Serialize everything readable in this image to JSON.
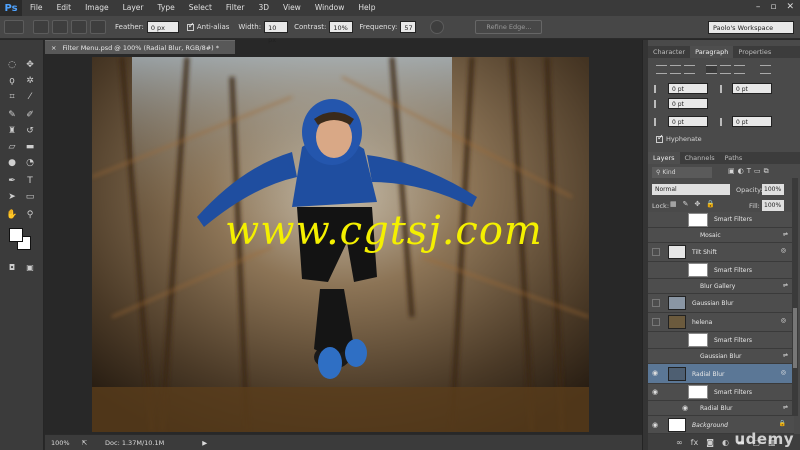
{
  "menu": {
    "app_logo": "Ps",
    "items": [
      "File",
      "Edit",
      "Image",
      "Layer",
      "Type",
      "Select",
      "Filter",
      "3D",
      "View",
      "Window",
      "Help"
    ]
  },
  "options": {
    "feather_label": "Feather:",
    "feather_value": "0 px",
    "antialias_label": "Anti-alias",
    "width_label": "Width:",
    "width_value": "10 px",
    "contrast_label": "Contrast:",
    "contrast_value": "10%",
    "frequency_label": "Frequency:",
    "frequency_value": "57",
    "refine_label": "Refine Edge...",
    "workspace": "Paolo's Workspace"
  },
  "document": {
    "tab_title": "Filter Menu.psd @ 100% (Radial Blur, RGB/8#) *",
    "tab_close": "×",
    "zoom": "100%",
    "doc_size": "Doc: 1.37M/10.1M",
    "watermark": "www.cgtsj.com"
  },
  "panels": {
    "top_tabs": [
      "Character",
      "Paragraph",
      "Properties"
    ],
    "active_top_tab": "Paragraph",
    "para_values": [
      "0 pt",
      "0 pt",
      "0 pt",
      "0 pt",
      "0 pt"
    ],
    "hyphenate_label": "Hyphenate",
    "layer_tabs": [
      "Layers",
      "Channels",
      "Paths"
    ],
    "kind_label": "Kind",
    "blend_mode": "Normal",
    "opacity_label": "Opacity:",
    "opacity_value": "100%",
    "lock_label": "Lock:",
    "fill_label": "Fill:",
    "fill_value": "100%"
  },
  "layers": [
    {
      "name": "Smart Filters",
      "type": "smart"
    },
    {
      "name": "Mosaic",
      "type": "filter"
    },
    {
      "name": "Tilt Shift",
      "type": "layer"
    },
    {
      "name": "Smart Filters",
      "type": "smart"
    },
    {
      "name": "Blur Gallery",
      "type": "filter"
    },
    {
      "name": "Gaussian Blur",
      "type": "layer"
    },
    {
      "name": "helena",
      "type": "layer"
    },
    {
      "name": "Smart Filters",
      "type": "smart"
    },
    {
      "name": "Gaussian Blur",
      "type": "filter"
    },
    {
      "name": "Radial Blur",
      "type": "layer-selected"
    },
    {
      "name": "Smart Filters",
      "type": "smart"
    },
    {
      "name": "Radial Blur",
      "type": "filter"
    },
    {
      "name": "Background",
      "type": "background"
    }
  ],
  "footer_icons": [
    "link-icon",
    "fx-icon",
    "mask-icon",
    "adjustment-icon",
    "folder-icon",
    "new-layer-icon",
    "trash-icon"
  ],
  "brand": "udemy",
  "colors": {
    "accent_selected": "#5b7796",
    "watermark": "#f4f000"
  }
}
